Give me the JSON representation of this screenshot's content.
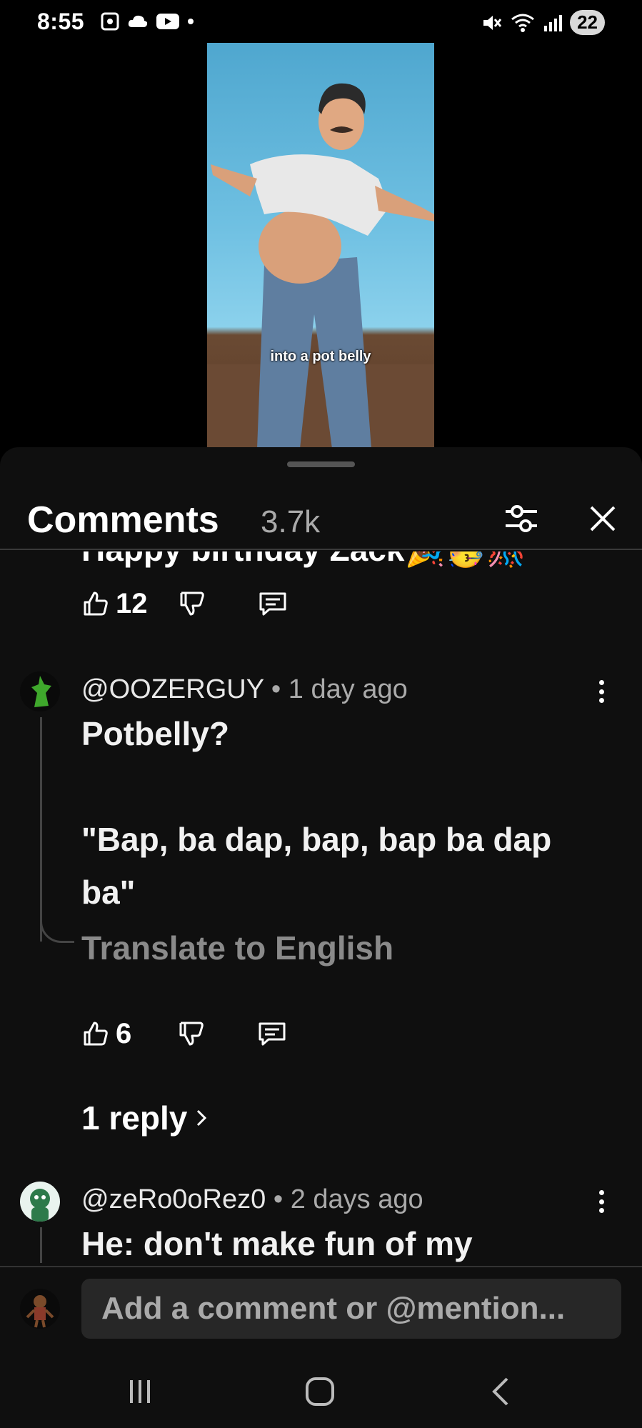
{
  "status_bar": {
    "time": "8:55",
    "battery": "22"
  },
  "video": {
    "subtitle": "into a pot belly"
  },
  "comments_panel": {
    "title": "Comments",
    "count": "3.7k"
  },
  "comments": [
    {
      "partial_text": "Happy birthday Zack🎉🥳🎊",
      "likes": "12"
    },
    {
      "username": "@OOZERGUY",
      "separator": "•",
      "time": "1 day ago",
      "line1": "Potbelly?",
      "line2": "\"Bap, ba dap, bap, bap ba dap",
      "line3": "ba\"",
      "translate": "Translate to English",
      "likes": "6",
      "replies": "1 reply"
    },
    {
      "username": "@zeRo0oRez0",
      "separator": "•",
      "time": "2 days ago",
      "line1": "He: don't make fun of my"
    }
  ],
  "input": {
    "placeholder": "Add a comment or @mention..."
  },
  "colors": {
    "background": "#0f0f0f",
    "secondary_text": "#aaaaaa",
    "input_bg": "#272727"
  },
  "icons": [
    "thumb-up-icon",
    "thumb-down-icon",
    "reply-icon",
    "more-vert-icon",
    "filter-icon",
    "close-icon"
  ]
}
